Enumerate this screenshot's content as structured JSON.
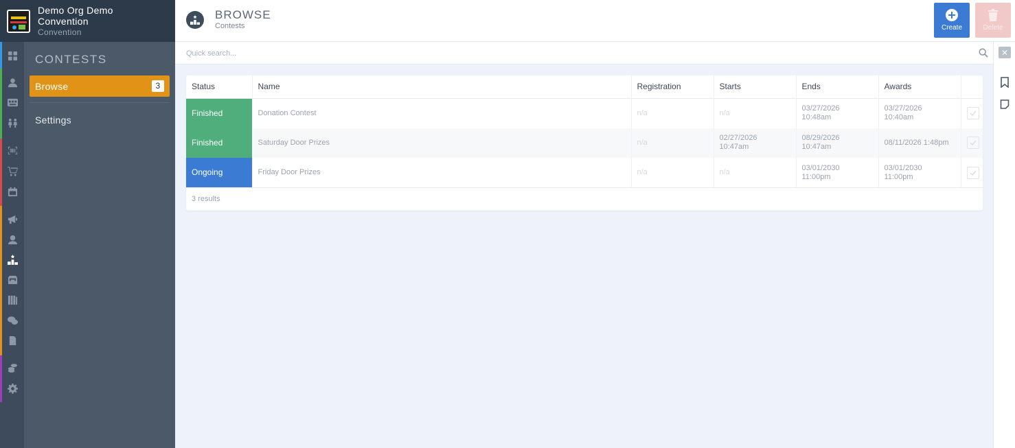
{
  "org": {
    "name": "Demo Org Demo Convention",
    "subtitle": "Convention"
  },
  "rail": {
    "items": [
      {
        "name": "dashboard-icon",
        "color": "#2f9be6"
      },
      {
        "name": "person-icon",
        "color": "#4caf50"
      },
      {
        "name": "badge-icon",
        "color": "#4caf50"
      },
      {
        "name": "people-icon",
        "color": "#4caf50"
      },
      {
        "name": "barcode-icon",
        "color": "#d84b4b"
      },
      {
        "name": "cart-icon",
        "color": "#d84b4b"
      },
      {
        "name": "calendar-icon",
        "color": "#d84b4b"
      },
      {
        "name": "megaphone-icon",
        "color": "#e09316"
      },
      {
        "name": "user-tie-icon",
        "color": "#e09316"
      },
      {
        "name": "podium-icon",
        "color": "#e09316"
      },
      {
        "name": "inbox-icon",
        "color": "#e09316"
      },
      {
        "name": "library-icon",
        "color": "#e09316"
      },
      {
        "name": "chat-icon",
        "color": "#e09316"
      },
      {
        "name": "document-icon",
        "color": "#e09316"
      },
      {
        "name": "coins-icon",
        "color": "#9c3fb8"
      },
      {
        "name": "gear-icon",
        "color": "#9c3fb8"
      }
    ]
  },
  "submenu": {
    "title": "CONTESTS",
    "items": [
      {
        "label": "Browse",
        "badge": "3",
        "active": true
      },
      {
        "label": "Settings"
      }
    ]
  },
  "header": {
    "title": "BROWSE",
    "subtitle": "Contests",
    "create_label": "Create",
    "delete_label": "Delete"
  },
  "search": {
    "placeholder": "Quick search..."
  },
  "table": {
    "columns": [
      "Status",
      "Name",
      "Registration",
      "Starts",
      "Ends",
      "Awards"
    ],
    "rows": [
      {
        "status": "Finished",
        "name": "Donation Contest",
        "registration": "n/a",
        "starts": "n/a",
        "ends": "03/27/2026\n10:48am",
        "awards": "03/27/2026\n10:40am"
      },
      {
        "status": "Finished",
        "name": "Saturday Door Prizes",
        "registration": "n/a",
        "starts": "02/27/2026\n10:47am",
        "ends": "08/29/2026\n10:47am",
        "awards": "08/11/2026 1:48pm"
      },
      {
        "status": "Ongoing",
        "name": "Friday Door Prizes",
        "registration": "n/a",
        "starts": "n/a",
        "ends": "03/01/2030\n11:00pm",
        "awards": "03/01/2030\n11:00pm"
      }
    ],
    "results": "3 results"
  },
  "colors": {
    "finished": "#4fae7b",
    "ongoing": "#3b7bd4",
    "accent": "#e09316",
    "create": "#3b7bd4"
  }
}
